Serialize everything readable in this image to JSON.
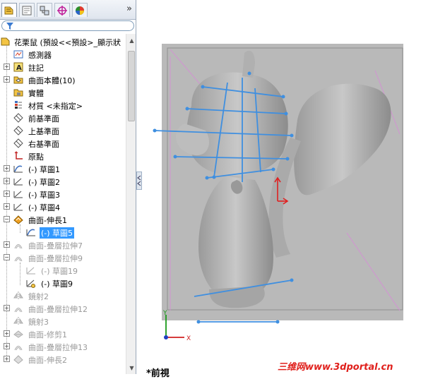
{
  "tabs": [
    {
      "name": "feature-manager"
    },
    {
      "name": "property-manager"
    },
    {
      "name": "configuration-manager"
    },
    {
      "name": "dimxpert-manager"
    },
    {
      "name": "display-manager"
    }
  ],
  "tab_more": "»",
  "tree": {
    "root": "花栗鼠 (預設<<預設>_顯示狀",
    "items": [
      {
        "label": "感測器"
      },
      {
        "label": "註記"
      },
      {
        "label": "曲面本體(10)"
      },
      {
        "label": "實體"
      },
      {
        "label": "材質 <未指定>"
      },
      {
        "label": "前基準面"
      },
      {
        "label": "上基準面"
      },
      {
        "label": "右基準面"
      },
      {
        "label": "原點"
      },
      {
        "label": "(-) 草圖1"
      },
      {
        "label": "(-) 草圖2"
      },
      {
        "label": "(-) 草圖3"
      },
      {
        "label": "(-) 草圖4"
      },
      {
        "label": "曲面-伸長1"
      },
      {
        "label": "(-) 草圖5"
      },
      {
        "label": "曲面-疊層拉伸7"
      },
      {
        "label": "曲面-疊層拉伸9"
      },
      {
        "label": "(-) 草圖19"
      },
      {
        "label": "(-) 草圖9"
      },
      {
        "label": "鏡射2"
      },
      {
        "label": "曲面-疊層拉伸12"
      },
      {
        "label": "鏡射3"
      },
      {
        "label": "曲面-修剪1"
      },
      {
        "label": "曲面-疊層拉伸13"
      },
      {
        "label": "曲面-伸長2"
      }
    ]
  },
  "viewport": {
    "view_name": "*前視",
    "triad_x": "X",
    "triad_y": "Y"
  },
  "watermark": "三维网www.3dportal.cn"
}
